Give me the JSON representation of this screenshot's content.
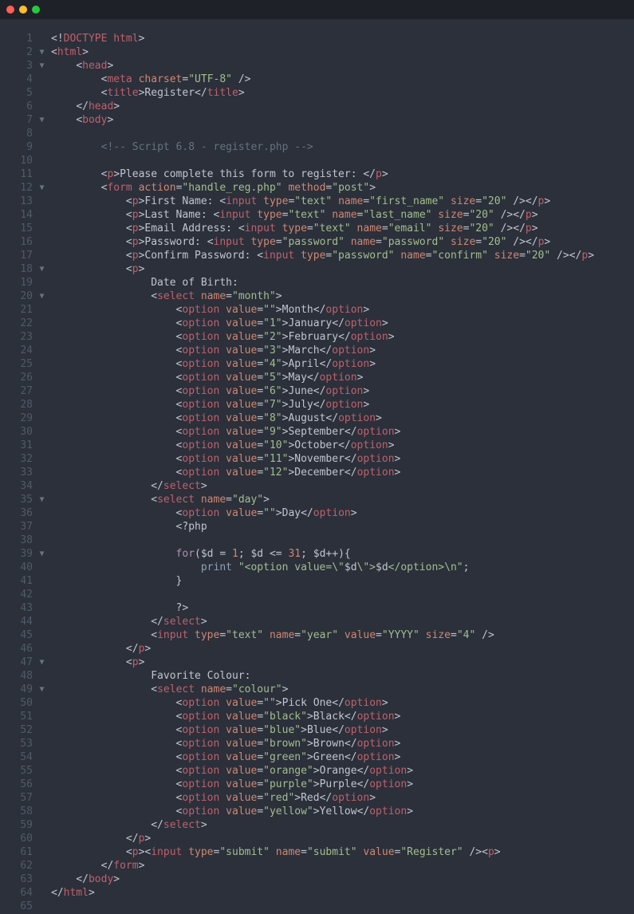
{
  "titlebar": {
    "dots": [
      "red",
      "yellow",
      "green"
    ]
  },
  "gutter": {
    "start": 1,
    "end": 65
  },
  "fold": {
    "2": "▼",
    "3": "▼",
    "7": "▼",
    "12": "▼",
    "18": "▼",
    "20": "▼",
    "35": "▼",
    "39": "▼",
    "47": "▼",
    "49": "▼"
  },
  "code": {
    "l1": {
      "raw": "<!DOCTYPE html>"
    },
    "l2": {
      "open": "html"
    },
    "l3": {
      "indent": "    ",
      "open": "head"
    },
    "l4": {
      "indent": "        ",
      "tag": "meta",
      "attrs": [
        [
          "charset",
          "UTF-8"
        ]
      ],
      "self": true
    },
    "l5": {
      "indent": "        ",
      "tag": "title",
      "text": "Register"
    },
    "l6": {
      "indent": "    ",
      "close": "head"
    },
    "l7": {
      "indent": "    ",
      "open": "body"
    },
    "l8": {
      "blank": true
    },
    "l9": {
      "indent": "        ",
      "comment": "<!-- Script 6.8 - register.php -->"
    },
    "l10": {
      "blank": true
    },
    "l11": {
      "indent": "        ",
      "tag": "p",
      "text": "Please complete this form to register: "
    },
    "l12": {
      "indent": "        ",
      "open": "form",
      "attrs": [
        [
          "action",
          "handle_reg.php"
        ],
        [
          "method",
          "post"
        ]
      ]
    },
    "l13": {
      "indent": "            ",
      "ptag": true,
      "label": "First Name: ",
      "itag": "input",
      "iattrs": [
        [
          "type",
          "text"
        ],
        [
          "name",
          "first_name"
        ],
        [
          "size",
          "20"
        ]
      ]
    },
    "l14": {
      "indent": "            ",
      "ptag": true,
      "label": "Last Name: ",
      "itag": "input",
      "iattrs": [
        [
          "type",
          "text"
        ],
        [
          "name",
          "last_name"
        ],
        [
          "size",
          "20"
        ]
      ]
    },
    "l15": {
      "indent": "            ",
      "ptag": true,
      "label": "Email Address: ",
      "itag": "input",
      "iattrs": [
        [
          "type",
          "text"
        ],
        [
          "name",
          "email"
        ],
        [
          "size",
          "20"
        ]
      ]
    },
    "l16": {
      "indent": "            ",
      "ptag": true,
      "label": "Password: ",
      "itag": "input",
      "iattrs": [
        [
          "type",
          "password"
        ],
        [
          "name",
          "password"
        ],
        [
          "size",
          "20"
        ]
      ]
    },
    "l17": {
      "indent": "            ",
      "ptag": true,
      "label": "Confirm Password: ",
      "itag": "input",
      "iattrs": [
        [
          "type",
          "password"
        ],
        [
          "name",
          "confirm"
        ],
        [
          "size",
          "20"
        ]
      ]
    },
    "l18": {
      "indent": "            ",
      "open": "p"
    },
    "l19": {
      "indent": "                ",
      "plain": "Date of Birth:"
    },
    "l20": {
      "indent": "                ",
      "open": "select",
      "attrs": [
        [
          "name",
          "month"
        ]
      ]
    },
    "l21": {
      "indent": "                    ",
      "tag": "option",
      "attrs": [
        [
          "value",
          ""
        ]
      ],
      "text": "Month"
    },
    "l22": {
      "indent": "                    ",
      "tag": "option",
      "attrs": [
        [
          "value",
          "1"
        ]
      ],
      "text": "January"
    },
    "l23": {
      "indent": "                    ",
      "tag": "option",
      "attrs": [
        [
          "value",
          "2"
        ]
      ],
      "text": "February"
    },
    "l24": {
      "indent": "                    ",
      "tag": "option",
      "attrs": [
        [
          "value",
          "3"
        ]
      ],
      "text": "March"
    },
    "l25": {
      "indent": "                    ",
      "tag": "option",
      "attrs": [
        [
          "value",
          "4"
        ]
      ],
      "text": "April"
    },
    "l26": {
      "indent": "                    ",
      "tag": "option",
      "attrs": [
        [
          "value",
          "5"
        ]
      ],
      "text": "May"
    },
    "l27": {
      "indent": "                    ",
      "tag": "option",
      "attrs": [
        [
          "value",
          "6"
        ]
      ],
      "text": "June"
    },
    "l28": {
      "indent": "                    ",
      "tag": "option",
      "attrs": [
        [
          "value",
          "7"
        ]
      ],
      "text": "July"
    },
    "l29": {
      "indent": "                    ",
      "tag": "option",
      "attrs": [
        [
          "value",
          "8"
        ]
      ],
      "text": "August"
    },
    "l30": {
      "indent": "                    ",
      "tag": "option",
      "attrs": [
        [
          "value",
          "9"
        ]
      ],
      "text": "September"
    },
    "l31": {
      "indent": "                    ",
      "tag": "option",
      "attrs": [
        [
          "value",
          "10"
        ]
      ],
      "text": "October"
    },
    "l32": {
      "indent": "                    ",
      "tag": "option",
      "attrs": [
        [
          "value",
          "11"
        ]
      ],
      "text": "November"
    },
    "l33": {
      "indent": "                    ",
      "tag": "option",
      "attrs": [
        [
          "value",
          "12"
        ]
      ],
      "text": "December"
    },
    "l34": {
      "indent": "                ",
      "close": "select"
    },
    "l35": {
      "indent": "                ",
      "open": "select",
      "attrs": [
        [
          "name",
          "day"
        ]
      ]
    },
    "l36": {
      "indent": "                    ",
      "tag": "option",
      "attrs": [
        [
          "value",
          ""
        ]
      ],
      "text": "Day"
    },
    "l37": {
      "indent": "                    ",
      "plain": "<?php"
    },
    "l38": {
      "blank": true
    },
    "l39": {
      "indent": "                    ",
      "php_for": true
    },
    "l40": {
      "indent": "                        ",
      "php_print": true
    },
    "l41": {
      "indent": "                    ",
      "plain": "}"
    },
    "l42": {
      "blank": true
    },
    "l43": {
      "indent": "                    ",
      "plain": "?>"
    },
    "l44": {
      "indent": "                ",
      "close": "select"
    },
    "l45": {
      "indent": "                ",
      "selfclose": "input",
      "attrs": [
        [
          "type",
          "text"
        ],
        [
          "name",
          "year"
        ],
        [
          "value",
          "YYYY"
        ],
        [
          "size",
          "4"
        ]
      ]
    },
    "l46": {
      "indent": "            ",
      "close": "p"
    },
    "l47": {
      "indent": "            ",
      "open": "p"
    },
    "l48": {
      "indent": "                ",
      "plain": "Favorite Colour:"
    },
    "l49": {
      "indent": "                ",
      "open": "select",
      "attrs": [
        [
          "name",
          "colour"
        ]
      ]
    },
    "l50": {
      "indent": "                    ",
      "tag": "option",
      "attrs": [
        [
          "value",
          ""
        ]
      ],
      "text": "Pick One"
    },
    "l51": {
      "indent": "                    ",
      "tag": "option",
      "attrs": [
        [
          "value",
          "black"
        ]
      ],
      "text": "Black"
    },
    "l52": {
      "indent": "                    ",
      "tag": "option",
      "attrs": [
        [
          "value",
          "blue"
        ]
      ],
      "text": "Blue"
    },
    "l53": {
      "indent": "                    ",
      "tag": "option",
      "attrs": [
        [
          "value",
          "brown"
        ]
      ],
      "text": "Brown"
    },
    "l54": {
      "indent": "                    ",
      "tag": "option",
      "attrs": [
        [
          "value",
          "green"
        ]
      ],
      "text": "Green"
    },
    "l55": {
      "indent": "                    ",
      "tag": "option",
      "attrs": [
        [
          "value",
          "orange"
        ]
      ],
      "text": "Orange"
    },
    "l56": {
      "indent": "                    ",
      "tag": "option",
      "attrs": [
        [
          "value",
          "purple"
        ]
      ],
      "text": "Purple"
    },
    "l57": {
      "indent": "                    ",
      "tag": "option",
      "attrs": [
        [
          "value",
          "red"
        ]
      ],
      "text": "Red"
    },
    "l58": {
      "indent": "                    ",
      "tag": "option",
      "attrs": [
        [
          "value",
          "yellow"
        ]
      ],
      "text": "Yellow"
    },
    "l59": {
      "indent": "                ",
      "close": "select"
    },
    "l60": {
      "indent": "            ",
      "close": "p"
    },
    "l61": {
      "indent": "            ",
      "psubmit": true,
      "iattrs": [
        [
          "type",
          "submit"
        ],
        [
          "name",
          "submit"
        ],
        [
          "value",
          "Register"
        ]
      ]
    },
    "l62": {
      "indent": "        ",
      "close": "form"
    },
    "l63": {
      "indent": "    ",
      "close": "body"
    },
    "l64": {
      "close": "html"
    },
    "l65": {
      "blank": true
    }
  }
}
